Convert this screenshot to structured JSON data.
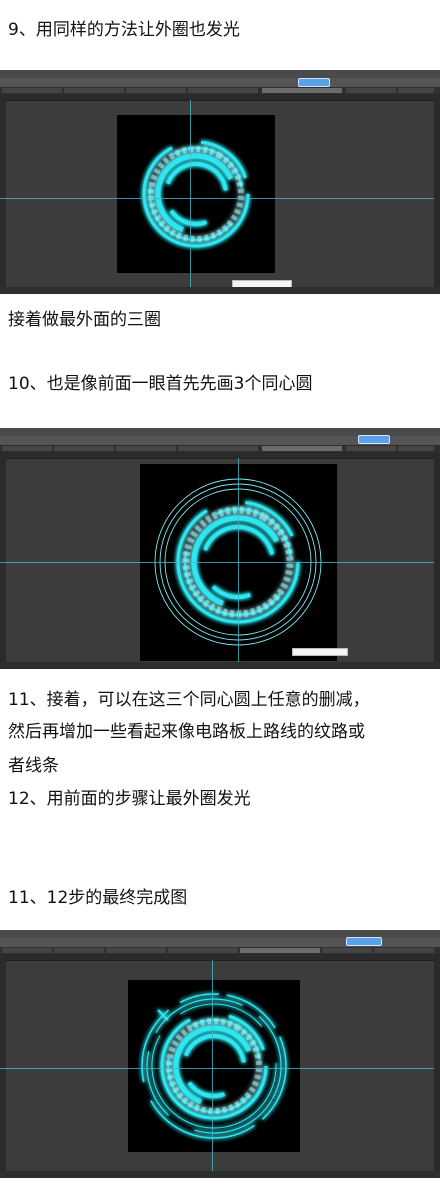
{
  "steps": {
    "step9": "9、用同样的方法让外圈也发光",
    "step9_note": "接着做最外面的三圈",
    "step10": "10、也是像前面一眼首先先画3个同心圆",
    "step11_l1": "11、接着，可以在这三个同心圆上任意的删减，",
    "step11_l2": "然后再增加一些看起来像电路板上路线的纹路或",
    "step11_l3": "者线条",
    "step12": "12、用前面的步骤让最外圈发光",
    "step_final": "11、12步的最终完成图"
  },
  "colors": {
    "glow": "#2ee6f0",
    "ring": "#7fe9f2",
    "canvas_bg": "#000000",
    "app_bg": "#3c3c3c",
    "guide": "#3fb8c9"
  }
}
